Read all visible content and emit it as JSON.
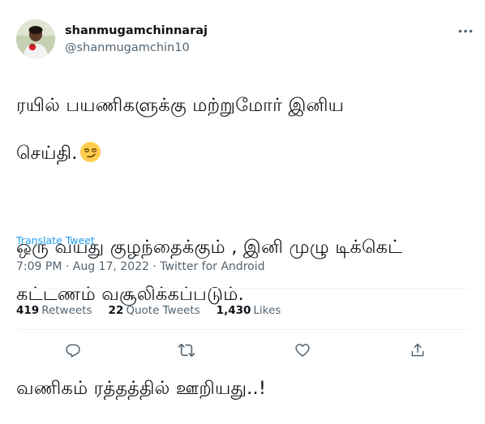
{
  "tweet": {
    "display_name": "shanmugamchinnaraj",
    "handle": "@shanmugamchin10",
    "lines": [
      "ரயில் பயணிகளுக்கு மற்றுமோர் இனிய",
      "செய்தி.",
      "ஒரு வயது குழந்தைக்கும் , இனி முழு டிக்கெட்",
      "கட்டணம் வசூலிக்கப்படும்.",
      "வணிகம் ரத்தத்தில் ஊறியது..!"
    ],
    "translate_label": "Translate Tweet",
    "time": "7:09 PM",
    "date": "Aug 17, 2022",
    "source": "Twitter for Android",
    "separator": "·"
  },
  "stats": {
    "retweets_count": "419",
    "retweets_label": "Retweets",
    "quotes_count": "22",
    "quotes_label": "Quote Tweets",
    "likes_count": "1,430",
    "likes_label": "Likes"
  },
  "icons": {
    "more": "more-horizontal-icon",
    "reply": "reply-icon",
    "retweet": "retweet-icon",
    "like": "heart-icon",
    "share": "share-icon",
    "emoji": "smirking-face-emoji"
  },
  "colors": {
    "text": "#0f1419",
    "secondary": "#536471",
    "link": "#1d9bf0",
    "divider": "#eff3f4"
  }
}
